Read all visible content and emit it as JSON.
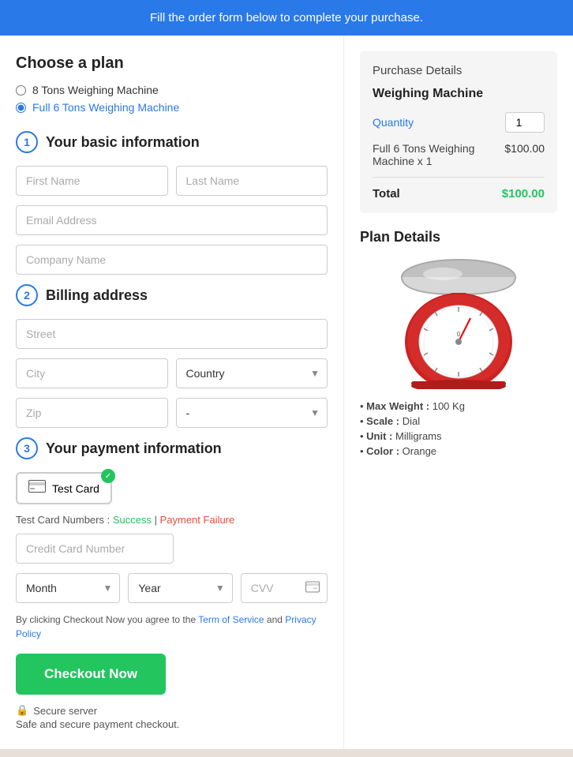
{
  "banner": {
    "text": "Fill the order form below to complete your purchase."
  },
  "left": {
    "choose_plan_title": "Choose a plan",
    "plans": [
      {
        "label": "8 Tons Weighing Machine",
        "selected": false
      },
      {
        "label": "Full 6 Tons Weighing Machine",
        "selected": true
      }
    ],
    "step1": {
      "number": "1",
      "label": "Your basic information",
      "fields": {
        "first_name_placeholder": "First Name",
        "last_name_placeholder": "Last Name",
        "email_placeholder": "Email Address",
        "company_placeholder": "Company Name"
      }
    },
    "step2": {
      "number": "2",
      "label": "Billing address",
      "fields": {
        "street_placeholder": "Street",
        "city_placeholder": "City",
        "country_placeholder": "Country",
        "zip_placeholder": "Zip",
        "state_placeholder": "-"
      }
    },
    "step3": {
      "number": "3",
      "label": "Your payment information",
      "card_label": "Test Card",
      "test_card_text": "Test Card Numbers : ",
      "success_link": "Success",
      "separator": " | ",
      "failure_link": "Payment Failure",
      "cc_placeholder": "Credit Card Number",
      "month_placeholder": "Month",
      "year_placeholder": "Year",
      "cvv_placeholder": "CVV"
    },
    "terms_text_1": "By clicking Checkout Now you agree to the ",
    "terms_link1": "Term of Service",
    "terms_text_2": " and ",
    "terms_link2": "Privacy Policy",
    "checkout_btn": "Checkout Now",
    "secure_label": "Secure server",
    "safe_text": "Safe and secure payment checkout."
  },
  "right": {
    "purchase_details_title": "Purchase Details",
    "product_name": "Weighing Machine",
    "quantity_label": "Quantity",
    "quantity_value": "1",
    "item_description": "Full 6 Tons Weighing Machine x 1",
    "item_price": "$100.00",
    "total_label": "Total",
    "total_price": "$100.00",
    "plan_details_title": "Plan Details",
    "specs": [
      {
        "key": "Max Weight",
        "value": "100 Kg"
      },
      {
        "key": "Scale",
        "value": "Dial"
      },
      {
        "key": "Unit",
        "value": "Milligrams"
      },
      {
        "key": "Color",
        "value": "Orange"
      }
    ]
  }
}
